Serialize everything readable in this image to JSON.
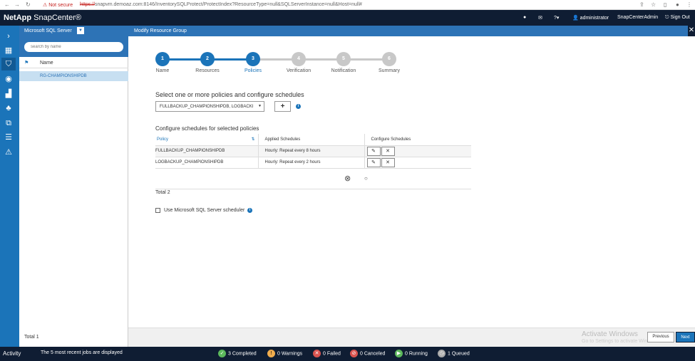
{
  "browser": {
    "url_warning": "Not secure",
    "url_scheme": "https://",
    "url_rest": "snapvm.demoaz.com:8146/InventorySQLProtect/ProtectIndex?ResourceType=null&SQLServerInstance=null&Host=null#"
  },
  "header": {
    "logo_brand": "NetApp",
    "logo_product": "SnapCenter®",
    "user": "administrator",
    "role": "SnapCenterAdmin",
    "signout": "Sign Out"
  },
  "resource_panel": {
    "title": "Microsoft SQL Server",
    "search_placeholder": "search by name",
    "column_name": "Name",
    "rows": [
      "RG-CHAMPIONSHIPDB"
    ],
    "total": "Total 1"
  },
  "main": {
    "title": "Modify Resource Group",
    "steps": [
      {
        "num": "1",
        "label": "Name",
        "state": "done"
      },
      {
        "num": "2",
        "label": "Resources",
        "state": "done"
      },
      {
        "num": "3",
        "label": "Policies",
        "state": "active"
      },
      {
        "num": "4",
        "label": "Verification",
        "state": "todo"
      },
      {
        "num": "5",
        "label": "Notification",
        "state": "todo"
      },
      {
        "num": "6",
        "label": "Summary",
        "state": "todo"
      }
    ],
    "select_label": "Select one or more policies and configure schedules",
    "selected_policies": "FULLBACKUP_CHAMPIONSHIPDB, LOGBACKI",
    "configure_label": "Configure schedules for selected policies",
    "table": {
      "headers": [
        "Policy",
        "Applied Schedules",
        "Configure Schedules"
      ],
      "rows": [
        {
          "policy": "FULLBACKUP_CHAMPIONSHIPDB",
          "schedule": "Hourly: Repeat every 8 hours"
        },
        {
          "policy": "LOGBACKUP_CHAMPIONSHIPDB",
          "schedule": "Hourly: Repeat every 2 hours"
        }
      ]
    },
    "total": "Total 2",
    "checkbox_label": "Use Microsoft SQL Server scheduler",
    "previous": "Previous",
    "next": "Next",
    "watermark_title": "Activate Windows",
    "watermark_sub": "Go to Settings to activate Windows."
  },
  "activity": {
    "label": "Activity",
    "summary": "The 5 most recent jobs are displayed",
    "completed": "3 Completed",
    "warnings": "0 Warnings",
    "failed": "0 Failed",
    "canceled": "0 Canceled",
    "running": "0 Running",
    "queued": "1 Queued"
  },
  "colors": {
    "accent": "#1b74b9",
    "header": "#0f1d33",
    "step_todo": "#c8c8c8"
  }
}
